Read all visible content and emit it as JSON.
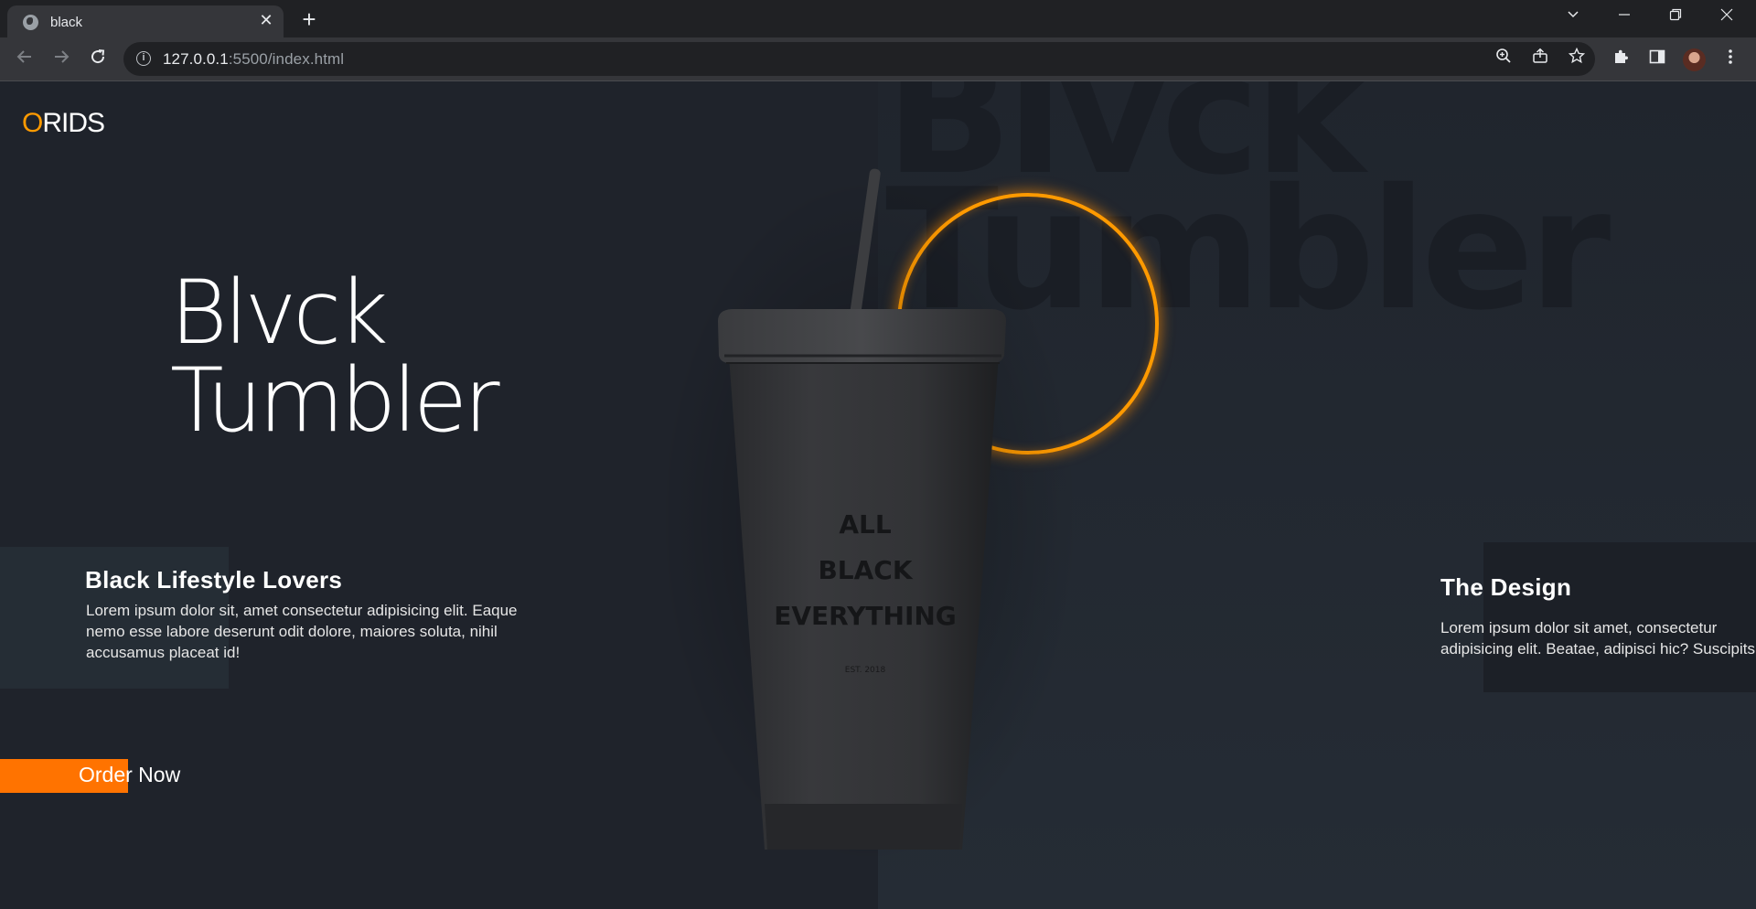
{
  "browser": {
    "tab_title": "black",
    "url_host": "127.0.0.1",
    "url_rest": ":5500/index.html",
    "tab_close": "✕",
    "new_tab": "+"
  },
  "page": {
    "logo_first": "O",
    "logo_rest": "RIDS",
    "hero_line1": "Blvck",
    "hero_line2": "Tumbler",
    "bg_line1": "Blvck",
    "bg_line2": "Tumbler",
    "left_card": {
      "title": "Black Lifestyle Lovers",
      "text": "Lorem ipsum dolor sit, amet consectetur adipisicing elit. Eaque nemo esse labore deserunt odit dolore, maiores soluta, nihil accusamus placeat id!"
    },
    "right_card": {
      "title": "The Design",
      "text_line1": "Lorem ipsum dolor sit amet, consectetur",
      "text_line2": "adipisicing elit. Beatae, adipisci hic? Suscipits"
    },
    "order_button": "Order Now",
    "product_print": {
      "line1": "ALL",
      "line2": "BLACK",
      "line3": "EVERYTHING",
      "small": "EST. 2018"
    },
    "colors": {
      "accent": "#ff7300",
      "logo_accent": "#ff9a00",
      "ring": "#ff9a00"
    }
  }
}
